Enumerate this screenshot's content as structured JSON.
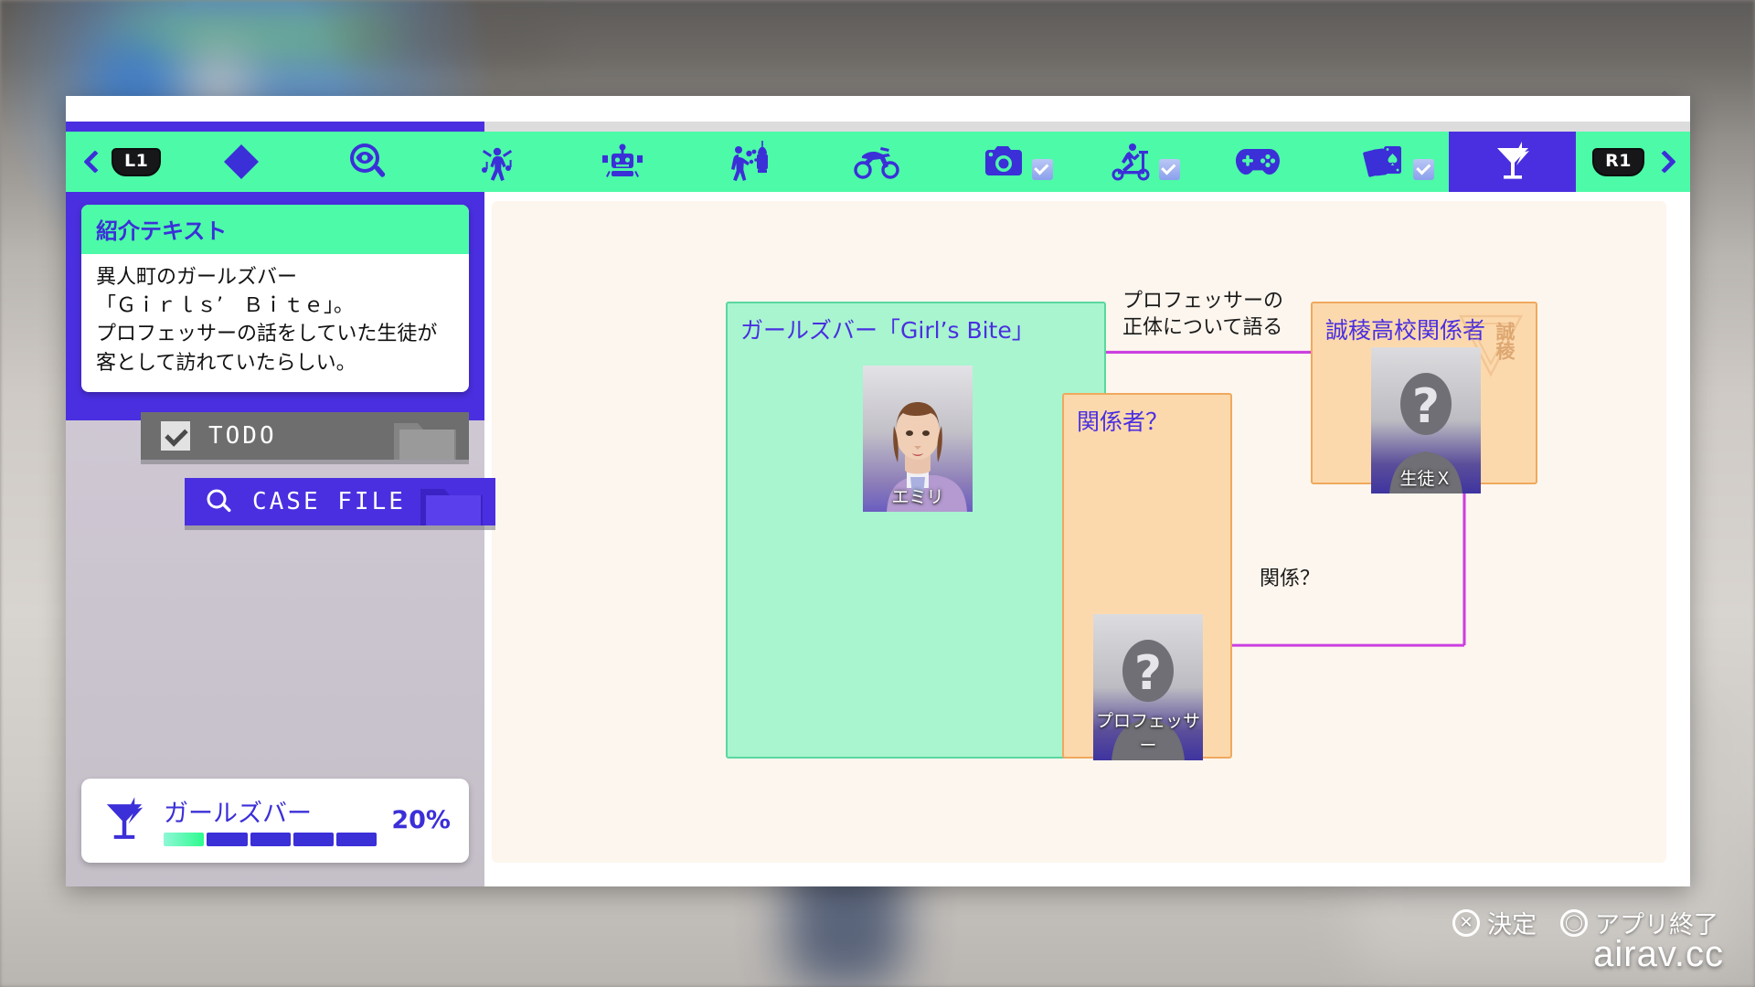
{
  "window": {
    "nav": {
      "left_bumper": "L1",
      "right_bumper": "R1",
      "prev_icon": "chevron-left-icon",
      "next_icon": "chevron-right-icon",
      "tabs": [
        {
          "icon": "diamond-icon",
          "label": "",
          "checked": false,
          "selected": false
        },
        {
          "icon": "eye-magnifier-icon",
          "label": "",
          "checked": false,
          "selected": false
        },
        {
          "icon": "dancer-music-icon",
          "label": "",
          "checked": false,
          "selected": false
        },
        {
          "icon": "robot-icon",
          "label": "",
          "checked": false,
          "selected": false
        },
        {
          "icon": "boxing-bag-icon",
          "label": "",
          "checked": false,
          "selected": false
        },
        {
          "icon": "motorcycle-icon",
          "label": "",
          "checked": false,
          "selected": false
        },
        {
          "icon": "camera-icon",
          "label": "",
          "checked": true,
          "selected": false
        },
        {
          "icon": "scooter-icon",
          "label": "",
          "checked": true,
          "selected": false
        },
        {
          "icon": "gamepad-icon",
          "label": "",
          "checked": false,
          "selected": false
        },
        {
          "icon": "playing-cards-icon",
          "label": "",
          "checked": true,
          "selected": false
        },
        {
          "icon": "cocktail-icon",
          "label": "",
          "checked": false,
          "selected": true
        }
      ]
    },
    "sidebar": {
      "intro": {
        "title": "紹介テキスト",
        "body": "異人町のガールズバー\n「Ｇｉｒｌｓ’　Ｂｉｔｅ」。\nプロフェッサーの話をしていた生徒が\n客として訪れていたらしい。"
      },
      "menu": [
        {
          "label": "TODO",
          "icon": "checkbox-icon",
          "selected": false
        },
        {
          "label": "CASE FILE",
          "icon": "magnifier-icon",
          "selected": true
        }
      ],
      "progress": {
        "icon": "cocktail-icon",
        "label": "ガールズバー",
        "percent_text": "20%",
        "percent_value": 20,
        "segments": 5,
        "segments_filled": 1
      }
    },
    "board": {
      "nodes": [
        {
          "id": "girls-bar",
          "title": "ガールズバー「Girl’s Bite」",
          "color": "green",
          "portraits": [
            {
              "name": "エミリ",
              "kind": "photo"
            }
          ]
        },
        {
          "id": "kankeisha",
          "title": "関係者？",
          "color": "orange",
          "portraits": [
            {
              "name": "プロフェッサー",
              "kind": "unknown"
            }
          ]
        },
        {
          "id": "seiryo-koko",
          "title": "誠稜高校関係者",
          "color": "orange",
          "watermark": "誠稜",
          "portraits": [
            {
              "name": "生徒Ｘ",
              "kind": "unknown"
            }
          ]
        }
      ],
      "edges": [
        {
          "from": "seiryo-koko",
          "to": "girls-bar",
          "label": "プロフェッサーの\n正体について語る"
        },
        {
          "from": "kankeisha-pro",
          "to": "seiryo-koko",
          "label": "関係？"
        }
      ]
    }
  },
  "footer": {
    "hints": [
      {
        "button": "✕",
        "label": "決定"
      },
      {
        "button": "◯",
        "label": "アプリ終了"
      }
    ]
  },
  "watermark": {
    "text": "airav.cc"
  },
  "colors": {
    "accent_purple": "#4a2fe0",
    "accent_green": "#4dfaa8",
    "node_green": "#a8f5cf",
    "node_orange": "#fcd9ad",
    "edge_magenta": "#cc3fe0"
  }
}
